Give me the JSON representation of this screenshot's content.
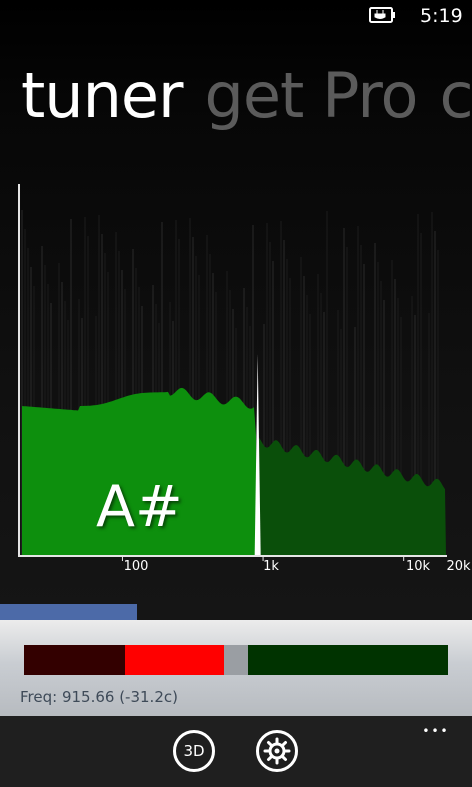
{
  "status_bar": {
    "time": "5:19",
    "battery_icon": "battery-charging-icon"
  },
  "pivot": {
    "active": "tuner",
    "inactive": [
      "get Pro",
      "c"
    ]
  },
  "spectrum": {
    "note": "A#",
    "peak_frequency": 915.66,
    "x_ticks": [
      "100",
      "1k",
      "10k",
      "20k"
    ],
    "x_scale": "log",
    "fill_color_below_peak": "#0d8f0d",
    "fill_color_above_peak": "#0a4f0a",
    "peak_marker_color": "#ffffff"
  },
  "level_bar": {
    "fraction": 0.29,
    "color": "#4c6aa8"
  },
  "tuning": {
    "freq_text": "Freq: 915.66 (-31.2c)",
    "segment_colors": [
      "#330000",
      "#ff0000",
      "#9a9ea3",
      "#003300"
    ]
  },
  "app_bar": {
    "buttons": [
      {
        "label": "3D",
        "icon": "3d-icon"
      },
      {
        "label": "",
        "icon": "gear-icon"
      }
    ],
    "more_label": "•••"
  }
}
